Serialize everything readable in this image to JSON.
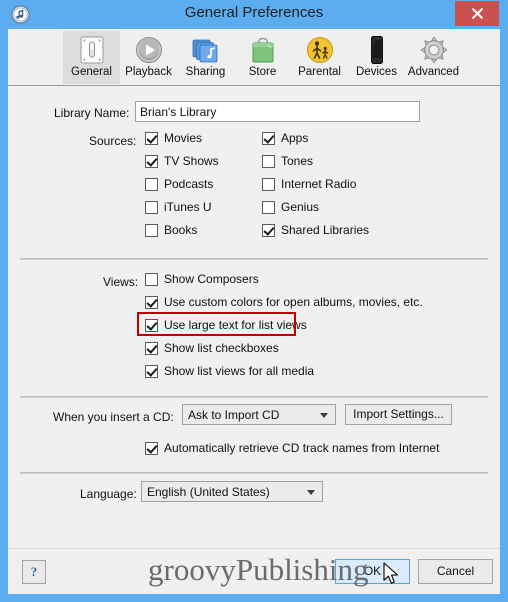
{
  "window": {
    "title": "General Preferences",
    "icon": "itunes-note-icon",
    "close_label": "✕",
    "frame_color": "#5badf0",
    "close_color": "#cb5151"
  },
  "toolbar": {
    "tabs": [
      {
        "label": "General",
        "icon": "lightswitch-icon",
        "selected": true
      },
      {
        "label": "Playback",
        "icon": "play-circle-icon",
        "selected": false
      },
      {
        "label": "Sharing",
        "icon": "stacked-music-icon",
        "selected": false
      },
      {
        "label": "Store",
        "icon": "shopping-bag-icon",
        "selected": false
      },
      {
        "label": "Parental",
        "icon": "parental-figures-icon",
        "selected": false
      },
      {
        "label": "Devices",
        "icon": "phone-icon",
        "selected": false
      },
      {
        "label": "Advanced",
        "icon": "gear-icon",
        "selected": false
      }
    ]
  },
  "library": {
    "label": "Library Name:",
    "value": "Brian's Library",
    "placeholder": "Library Name"
  },
  "sources": {
    "label": "Sources:",
    "left_column": [
      {
        "label": "Movies",
        "checked": true
      },
      {
        "label": "TV Shows",
        "checked": true
      },
      {
        "label": "Podcasts",
        "checked": false
      },
      {
        "label": "iTunes U",
        "checked": false
      },
      {
        "label": "Books",
        "checked": false
      }
    ],
    "right_column": [
      {
        "label": "Apps",
        "checked": true
      },
      {
        "label": "Tones",
        "checked": false
      },
      {
        "label": "Internet Radio",
        "checked": false
      },
      {
        "label": "Genius",
        "checked": false
      },
      {
        "label": "Shared Libraries",
        "checked": true
      }
    ]
  },
  "views": {
    "label": "Views:",
    "items": [
      {
        "label": "Show Composers",
        "checked": false,
        "highlighted": false
      },
      {
        "label": "Use custom colors for open albums, movies, etc.",
        "checked": true,
        "highlighted": false
      },
      {
        "label": "Use large text for list views",
        "checked": true,
        "highlighted": true
      },
      {
        "label": "Show list checkboxes",
        "checked": true,
        "highlighted": false
      },
      {
        "label": "Show list views for all media",
        "checked": true,
        "highlighted": false
      }
    ],
    "highlight_color": "#c00000"
  },
  "cd": {
    "label": "When you insert a CD:",
    "selected_option": "Ask to Import CD",
    "import_settings_label": "Import Settings...",
    "auto_retrieve": {
      "label": "Automatically retrieve CD track names from Internet",
      "checked": true
    }
  },
  "language": {
    "label": "Language:",
    "selected_option": "English (United States)"
  },
  "footer": {
    "help_label": "?",
    "watermark": "groovyPublishing",
    "ok_label": "OK",
    "cancel_label": "Cancel"
  }
}
